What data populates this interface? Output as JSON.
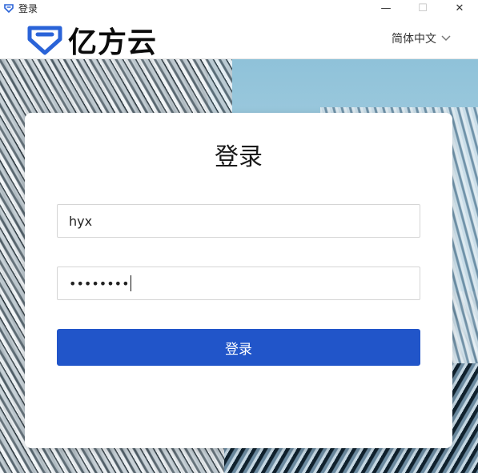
{
  "window": {
    "title": "登录",
    "controls": {
      "minimize": "—",
      "maximize": "☐",
      "close": "✕"
    }
  },
  "header": {
    "logo_text": "亿方云",
    "language": "简体中文"
  },
  "login": {
    "title": "登录",
    "username_value": "hyx",
    "password_value": "••••••••",
    "submit_label": "登录"
  },
  "colors": {
    "brand_blue": "#2155c9",
    "logo_blue": "#2a63d8"
  },
  "icons": {
    "app": "app-logo-icon",
    "logo_mark": "logo-mark-icon",
    "lang_chevron": "chevron-down-icon"
  }
}
